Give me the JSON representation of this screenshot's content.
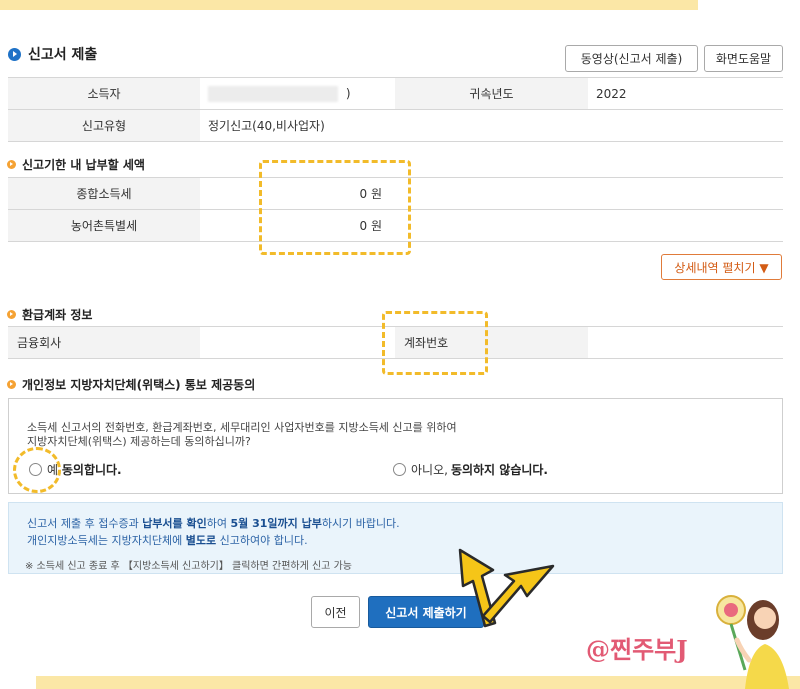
{
  "header": {
    "title": "신고서 제출",
    "video_button": "동영상(신고서 제출)",
    "help_button": "화면도움말"
  },
  "taxpayer": {
    "name_label": "소득자",
    "name_value_suffix": ")",
    "year_label": "귀속년도",
    "year_value": "2022",
    "type_label": "신고유형",
    "type_value": "정기신고(40,비사업자)"
  },
  "tax_due": {
    "heading": "신고기한 내 납부할 세액",
    "rows": [
      {
        "label": "종합소득세",
        "value": "0 원"
      },
      {
        "label": "농어촌특별세",
        "value": "0 원"
      }
    ],
    "detail_button": "상세내역 펼치기 ▼"
  },
  "refund_account": {
    "heading": "환급계좌 정보",
    "bank_label": "금융회사",
    "account_label": "계좌번호"
  },
  "consent": {
    "heading": "개인정보 지방자치단체(위택스) 통보 제공동의",
    "text_line1": "소득세 신고서의 전화번호, 환급계좌번호, 세무대리인 사업자번호를 지방소득세 신고를 위하여",
    "text_line2": "지방자치단체(위택스) 제공하는데 동의하십니까?",
    "yes_prefix": "예,",
    "yes_bold": "동의합니다.",
    "no_prefix": "아니오,",
    "no_bold": "동의하지 않습니다."
  },
  "notice": {
    "line1_a": "신고서 제출 후 접수증과 ",
    "line1_b": "납부서를 확인",
    "line1_c": "하여 ",
    "line1_d": "5월 31일까지 납부",
    "line1_e": "하시기 바랍니다.",
    "line2_a": "개인지방소득세는 지방자치단체에 ",
    "line2_b": "별도로",
    "line2_c": " 신고하여야 합니다.",
    "line3": "※ 소득세 신고 종료 후 【지방소득세 신고하기】 클릭하면 간편하게 신고 가능"
  },
  "buttons": {
    "prev": "이전",
    "submit": "신고서 제출하기"
  },
  "watermark": "@찐주부J",
  "colors": {
    "primary": "#1f6fbf",
    "highlight": "#f2bb2a",
    "accent_orange": "#e07b3a",
    "deco_band": "#fbe7a6"
  }
}
